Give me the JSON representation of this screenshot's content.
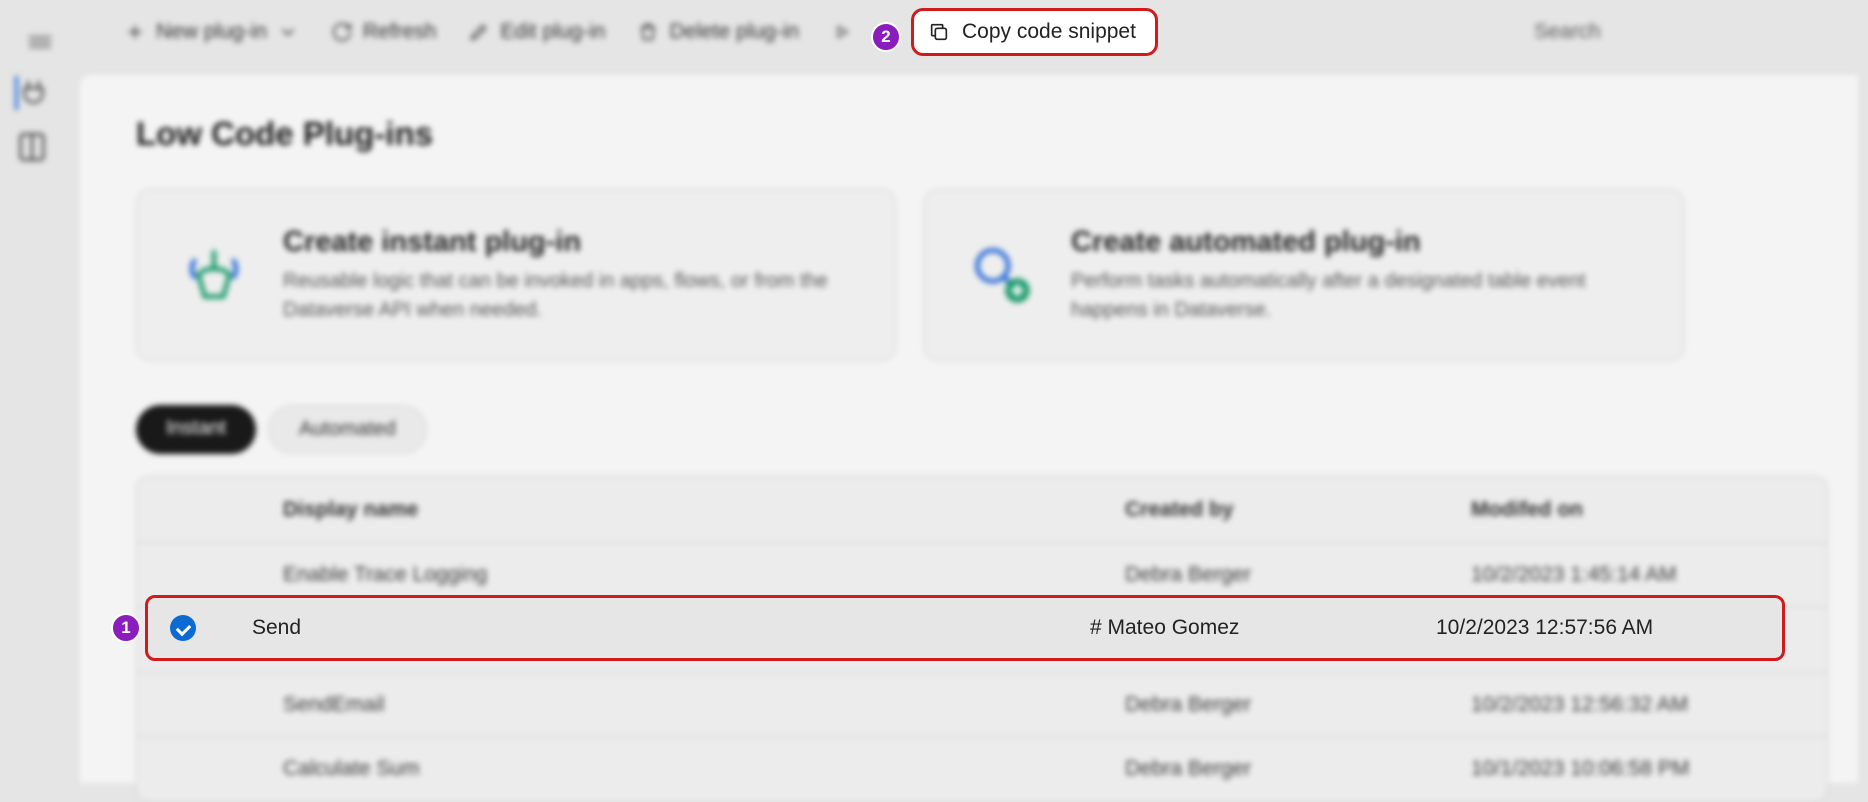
{
  "toolbar": {
    "new_plugin": "New plug-in",
    "refresh": "Refresh",
    "edit_plugin": "Edit plug-in",
    "delete_plugin": "Delete plug-in",
    "copy_snippet": "Copy code snippet",
    "search_placeholder": "Search"
  },
  "annotations": {
    "step1": "1",
    "step2": "2",
    "colors": {
      "badge_bg": "#8a1dbb",
      "highlight_border": "#d11a1a"
    }
  },
  "page": {
    "title": "Low Code Plug-ins"
  },
  "cards": {
    "instant": {
      "title": "Create instant plug-in",
      "desc": "Reusable logic that can be invoked in apps, flows, or from the Dataverse API when needed."
    },
    "automated": {
      "title": "Create automated plug-in",
      "desc": "Perform tasks automatically after a designated table event happens in Dataverse."
    }
  },
  "tabs": {
    "instant": "Instant",
    "automated": "Automated",
    "active": "instant"
  },
  "table": {
    "headers": {
      "name": "Display name",
      "created_by": "Created by",
      "modified_on": "Modifed on"
    },
    "rows": [
      {
        "name": "Enable Trace Logging",
        "created_by": "Debra Berger",
        "modified_on": "10/2/2023 1:45:14 AM",
        "selected": false
      },
      {
        "name": "Send",
        "created_by": "# Mateo Gomez",
        "modified_on": "10/2/2023 12:57:56 AM",
        "selected": true
      },
      {
        "name": "SendEmail",
        "created_by": "Debra Berger",
        "modified_on": "10/2/2023 12:56:32 AM",
        "selected": false
      },
      {
        "name": "Calculate Sum",
        "created_by": "Debra Berger",
        "modified_on": "10/1/2023 10:06:58 PM",
        "selected": false
      }
    ]
  }
}
